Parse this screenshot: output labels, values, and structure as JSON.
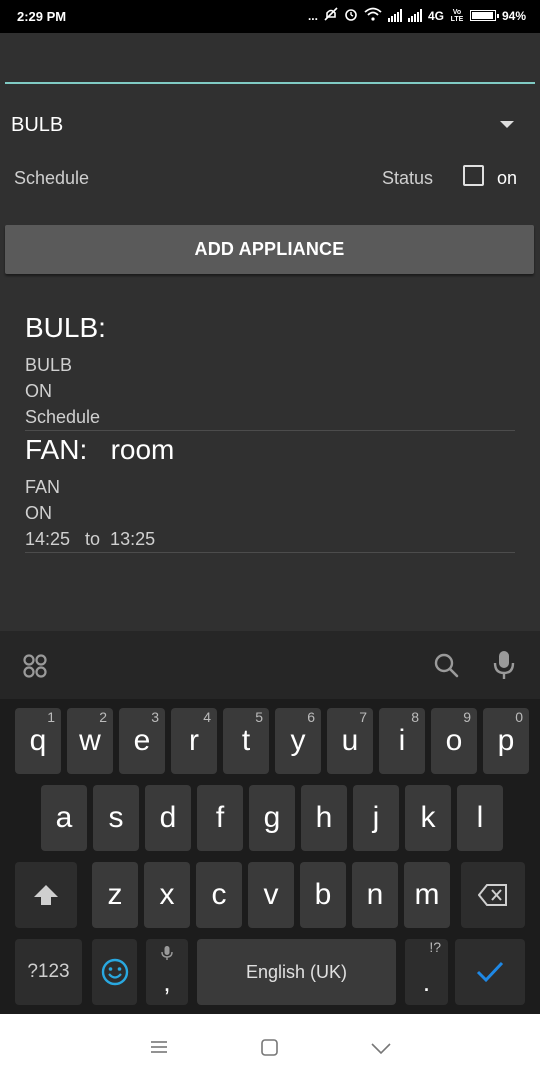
{
  "status_bar": {
    "time": "2:29 PM",
    "dots": "...",
    "network": "4G",
    "volte": "Vo LTE",
    "battery_level": 0.94,
    "battery_text": "94%"
  },
  "form": {
    "name_input_value": "",
    "appliance_spinner_value": "BULB",
    "schedule_label": "Schedule",
    "status_label": "Status",
    "status_checked": false,
    "on_label": "on",
    "add_button_label": "ADD APPLIANCE"
  },
  "appliances": [
    {
      "title": "BULB:",
      "type": "BULB",
      "status": "ON",
      "schedule": "Schedule"
    },
    {
      "title": "FAN:   room",
      "type": "FAN",
      "status": "ON",
      "schedule": "14:25   to  13:25"
    }
  ],
  "keyboard": {
    "row1": [
      {
        "key": "q",
        "hint": "1"
      },
      {
        "key": "w",
        "hint": "2"
      },
      {
        "key": "e",
        "hint": "3"
      },
      {
        "key": "r",
        "hint": "4"
      },
      {
        "key": "t",
        "hint": "5"
      },
      {
        "key": "y",
        "hint": "6"
      },
      {
        "key": "u",
        "hint": "7"
      },
      {
        "key": "i",
        "hint": "8"
      },
      {
        "key": "o",
        "hint": "9"
      },
      {
        "key": "p",
        "hint": "0"
      }
    ],
    "row2": [
      "a",
      "s",
      "d",
      "f",
      "g",
      "h",
      "j",
      "k",
      "l"
    ],
    "row3": [
      "z",
      "x",
      "c",
      "v",
      "b",
      "n",
      "m"
    ],
    "symbols_label": "?123",
    "comma": ",",
    "space_label": "English (UK)",
    "period": ".",
    "period_hint": "!?"
  },
  "colors": {
    "accent": "#80cbc4",
    "enter_check": "#1e88e5",
    "emoji": "#29a8e0"
  }
}
